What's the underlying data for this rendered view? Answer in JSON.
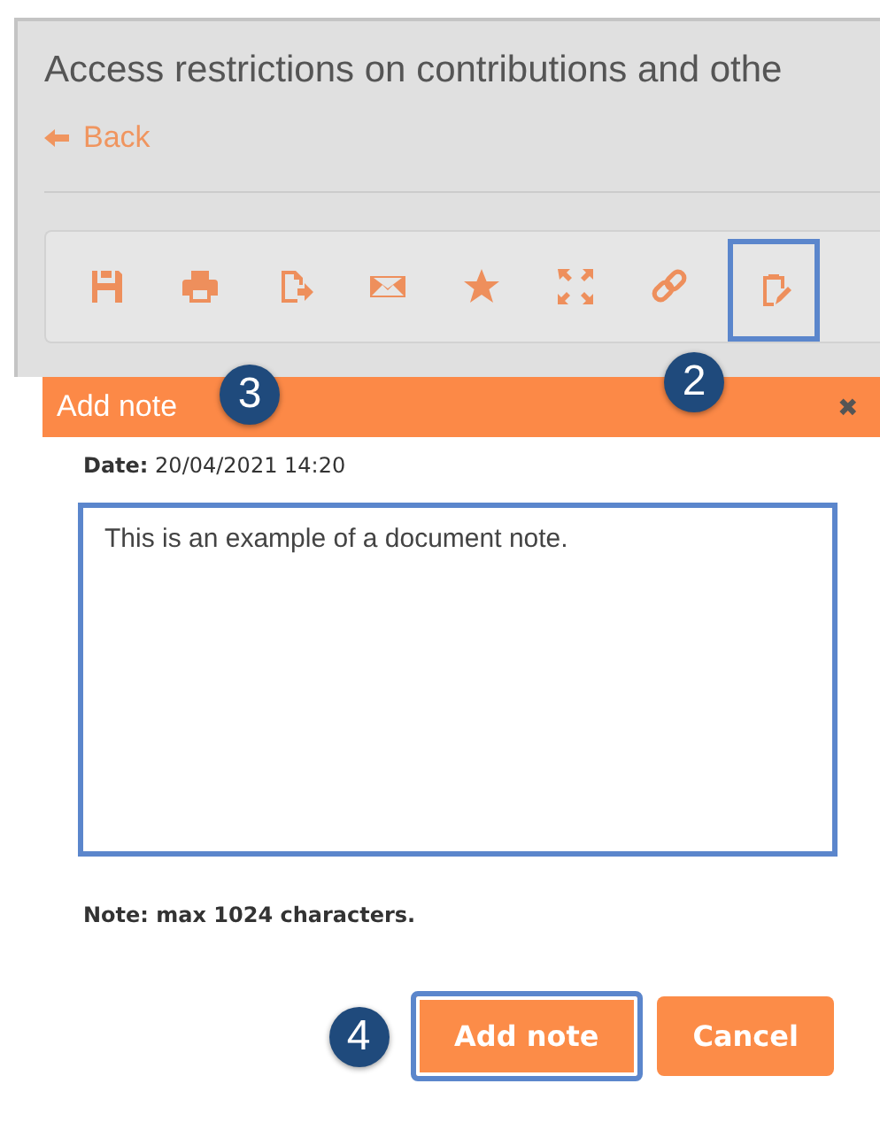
{
  "page": {
    "title": "Access restrictions on contributions and othe",
    "back_link": "Back"
  },
  "toolbar": [
    {
      "kind": "save",
      "highlighted": false
    },
    {
      "kind": "print",
      "highlighted": false
    },
    {
      "kind": "export",
      "highlighted": false
    },
    {
      "kind": "mail",
      "highlighted": false
    },
    {
      "kind": "star",
      "highlighted": false
    },
    {
      "kind": "expand",
      "highlighted": false
    },
    {
      "kind": "link",
      "highlighted": false
    },
    {
      "kind": "note",
      "highlighted": true,
      "callout": "2"
    }
  ],
  "dialog": {
    "title": "Add note",
    "title_callout": "3",
    "close": "✖",
    "date_label": "Date:",
    "date_value": "20/04/2021 14:20",
    "note_value": "This is an example of a document note.",
    "note_highlighted": true,
    "hint": "Note: max 1024 characters.",
    "buttons": [
      {
        "label": "Add note",
        "kind": "primary",
        "highlighted": true,
        "callout": "4"
      },
      {
        "label": "Cancel",
        "kind": "secondary",
        "highlighted": false
      }
    ]
  }
}
